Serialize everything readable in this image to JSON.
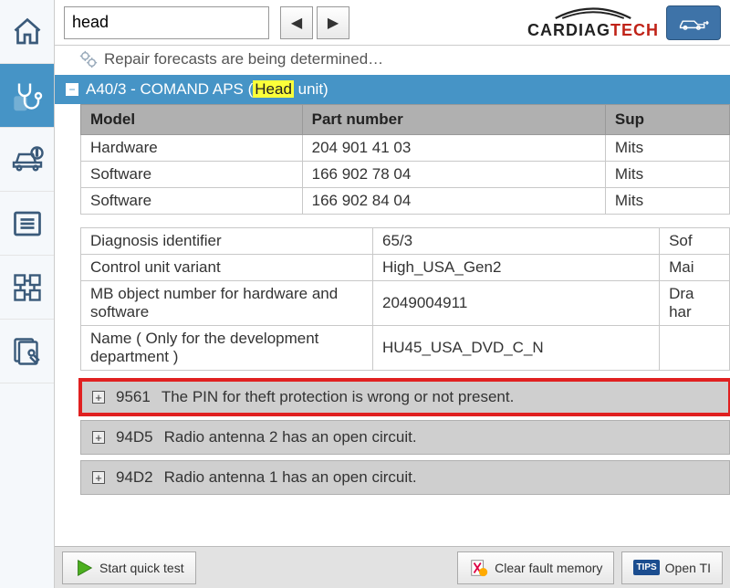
{
  "search": {
    "value": "head",
    "placeholder": ""
  },
  "brand": {
    "part1": "CARDIAG",
    "part2": "TECH"
  },
  "status": {
    "text": "Repair forecasts are being determined…"
  },
  "module_header": {
    "prefix": "A40/3 - COMAND APS (",
    "highlight": "Head",
    "suffix": " unit)"
  },
  "table1": {
    "headers": [
      "Model",
      "Part number",
      "Sup"
    ],
    "rows": [
      {
        "model": "Hardware",
        "part": "204 901 41 03",
        "sup": "Mits"
      },
      {
        "model": "Software",
        "part": "166 902 78 04",
        "sup": "Mits"
      },
      {
        "model": "Software",
        "part": "166 902 84 04",
        "sup": "Mits"
      }
    ]
  },
  "table2": {
    "rows": [
      {
        "label": "Diagnosis identifier",
        "value": "65/3",
        "extra": "Sof"
      },
      {
        "label": "Control unit variant",
        "value": "High_USA_Gen2",
        "extra": "Mai"
      },
      {
        "label": "MB object number for hardware and software",
        "value": "2049004911",
        "extra": "Dra\nhar"
      },
      {
        "label": "Name ( Only for the development department )",
        "value": "HU45_USA_DVD_C_N",
        "extra": ""
      }
    ]
  },
  "faults": [
    {
      "code": "9561",
      "text": "The PIN for theft protection is wrong or not present.",
      "highlighted": true
    },
    {
      "code": "94D5",
      "text": "Radio antenna 2 has an open circuit.",
      "highlighted": false
    },
    {
      "code": "94D2",
      "text": "Radio antenna 1 has an open circuit.",
      "highlighted": false
    }
  ],
  "toolbar": {
    "quick_test": "Start quick test",
    "clear_fault": "Clear fault memory",
    "open_tips": "Open TI"
  }
}
